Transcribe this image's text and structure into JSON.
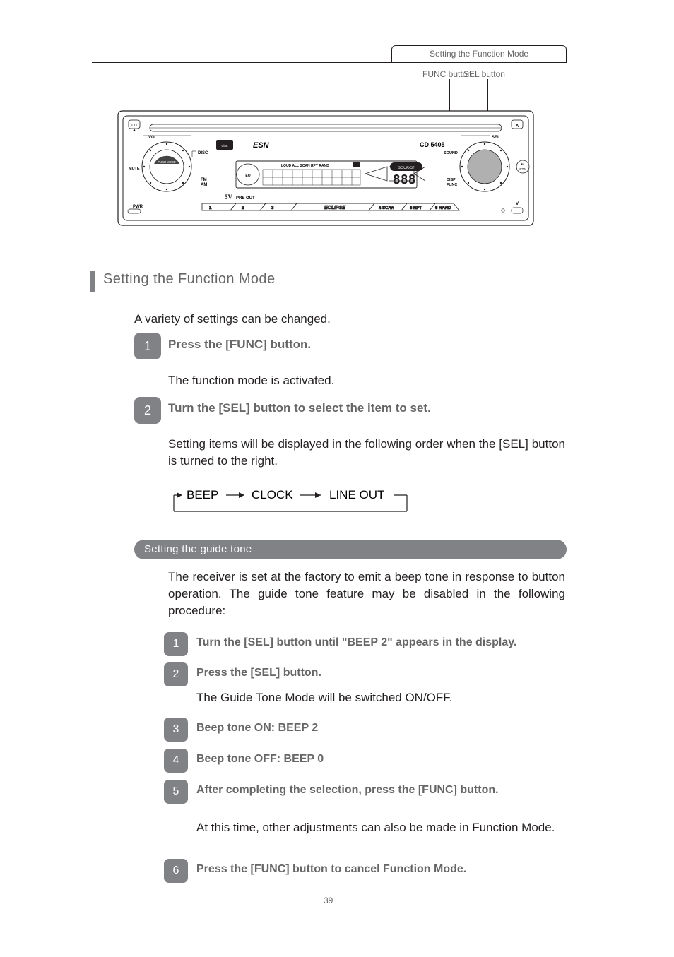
{
  "header": {
    "tab": "Setting the Function Mode"
  },
  "pointers": {
    "a": "FUNC button",
    "b": "SEL button"
  },
  "diagram": {
    "model": "CD 5405",
    "logo_prefix": "ESN",
    "indicators": "LOUD ALL SCAN RPT RAND",
    "source": "SOURCE",
    "eq": "EQ",
    "preout": "5V PRE OUT",
    "brand": "ECLIPSE",
    "btn1": "1",
    "btn2": "2",
    "btn3": "3",
    "btn4": "4  SCAN",
    "btn5": "5    RPT",
    "btn6": "6  RAND",
    "left_labels": {
      "cd": "CD",
      "vol": "VOL",
      "disc": "DISC",
      "mute": "MUTE",
      "fm": "FM",
      "am": "AM",
      "pwr": "PWR"
    },
    "right_labels": {
      "sel": "SEL",
      "sound": "SOUND",
      "disp": "DISP",
      "func": "FUNC",
      "rtn": "RTN"
    },
    "knob": "PUSH MODE"
  },
  "section": {
    "title": "Setting the Function Mode",
    "intro": "A variety of settings can be changed.",
    "step1": {
      "action": "Press the [FUNC] button.",
      "result": "The function mode is activated."
    },
    "step2": {
      "action": "Turn the [SEL] button to select the item to set.",
      "result": "Setting items will be displayed in the following order when the [SEL] button is turned to the right.",
      "cycle": {
        "a": "BEEP",
        "b": "CLOCK",
        "c": "LINE OUT"
      }
    },
    "guide": {
      "title": "Setting the guide tone",
      "intro": "The receiver is set at the factory to emit a beep tone in response to button operation. The guide tone feature may be disabled in the following procedure:",
      "s1": "Turn the [SEL] button until \"BEEP 2\" appears in the display.",
      "s2": {
        "action": "Press the [SEL] button.",
        "result": "The Guide Tone Mode will be switched ON/OFF."
      },
      "s3": "Beep tone ON: BEEP 2",
      "s4": "Beep tone OFF: BEEP 0",
      "s5": {
        "action": "After completing the selection, press the [FUNC] button.",
        "result": "At this time, other adjustments can also be made in Function Mode."
      },
      "s6": "Press the [FUNC] button to cancel Function Mode."
    }
  },
  "footer": {
    "page": "39"
  }
}
